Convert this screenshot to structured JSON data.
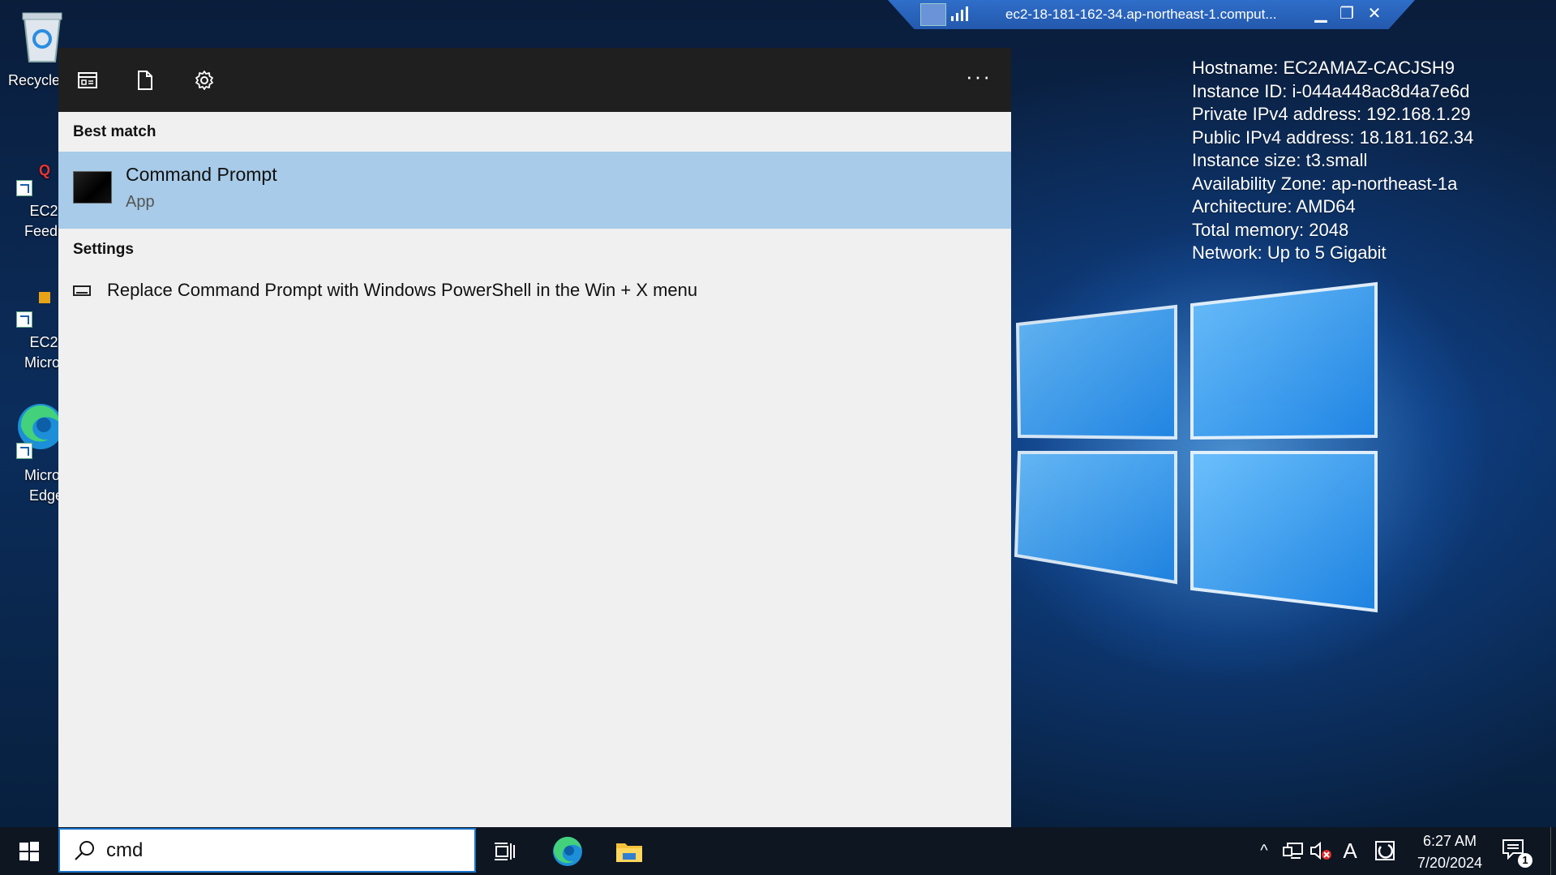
{
  "rdp_bar": {
    "title": "ec2-18-181-162-34.ap-northeast-1.comput...",
    "minimize_glyph": "▁",
    "restore_glyph": "❐",
    "close_glyph": "✕"
  },
  "desktop": {
    "icons": [
      {
        "label": "Recycle",
        "icon": "recycle-bin-icon"
      },
      {
        "label_line1": "EC2",
        "label_line2": "Feedba",
        "icon": "ec2-feedback-shortcut-icon"
      },
      {
        "label_line1": "EC2",
        "label_line2": "Micros",
        "icon": "ec2-microsoft-shortcut-icon"
      },
      {
        "label_line1": "Micros",
        "label_line2": "Edge",
        "icon": "microsoft-edge-icon"
      }
    ]
  },
  "sysinfo": {
    "lines": [
      "Hostname: EC2AMAZ-CACJSH9",
      "Instance ID: i-044a448ac8d4a7e6d",
      "Private IPv4 address: 192.168.1.29",
      "Public IPv4 address: 18.181.162.34",
      "Instance size: t3.small",
      "Availability Zone: ap-northeast-1a",
      "Architecture: AMD64",
      "Total memory: 2048",
      "Network: Up to 5 Gigabit"
    ]
  },
  "search_panel": {
    "toolbar": {
      "icons": [
        "apps-filter-icon",
        "documents-filter-icon",
        "settings-gear-icon"
      ],
      "more_label": "···"
    },
    "best_match_label": "Best match",
    "best_match": {
      "name": "Command Prompt",
      "type": "App"
    },
    "settings_label": "Settings",
    "settings_items": [
      {
        "text": "Replace Command Prompt with Windows PowerShell in the Win + X menu"
      }
    ]
  },
  "taskbar": {
    "search_value": "cmd",
    "apps": [
      "task-view-icon",
      "microsoft-edge-icon",
      "file-explorer-icon"
    ],
    "tray": {
      "chevron": "^",
      "ime_letter": "A",
      "time": "6:27 AM",
      "date": "7/20/2024",
      "notification_count": "1"
    }
  },
  "colors": {
    "panel_bg": "#f0f0f0",
    "toolbar_bg": "#1f1f1f",
    "selection_bg": "#a7cbe8",
    "taskbar_bg": "#0e1622",
    "search_border": "#1a73c9",
    "rdp_bar": "#2a64bd"
  }
}
